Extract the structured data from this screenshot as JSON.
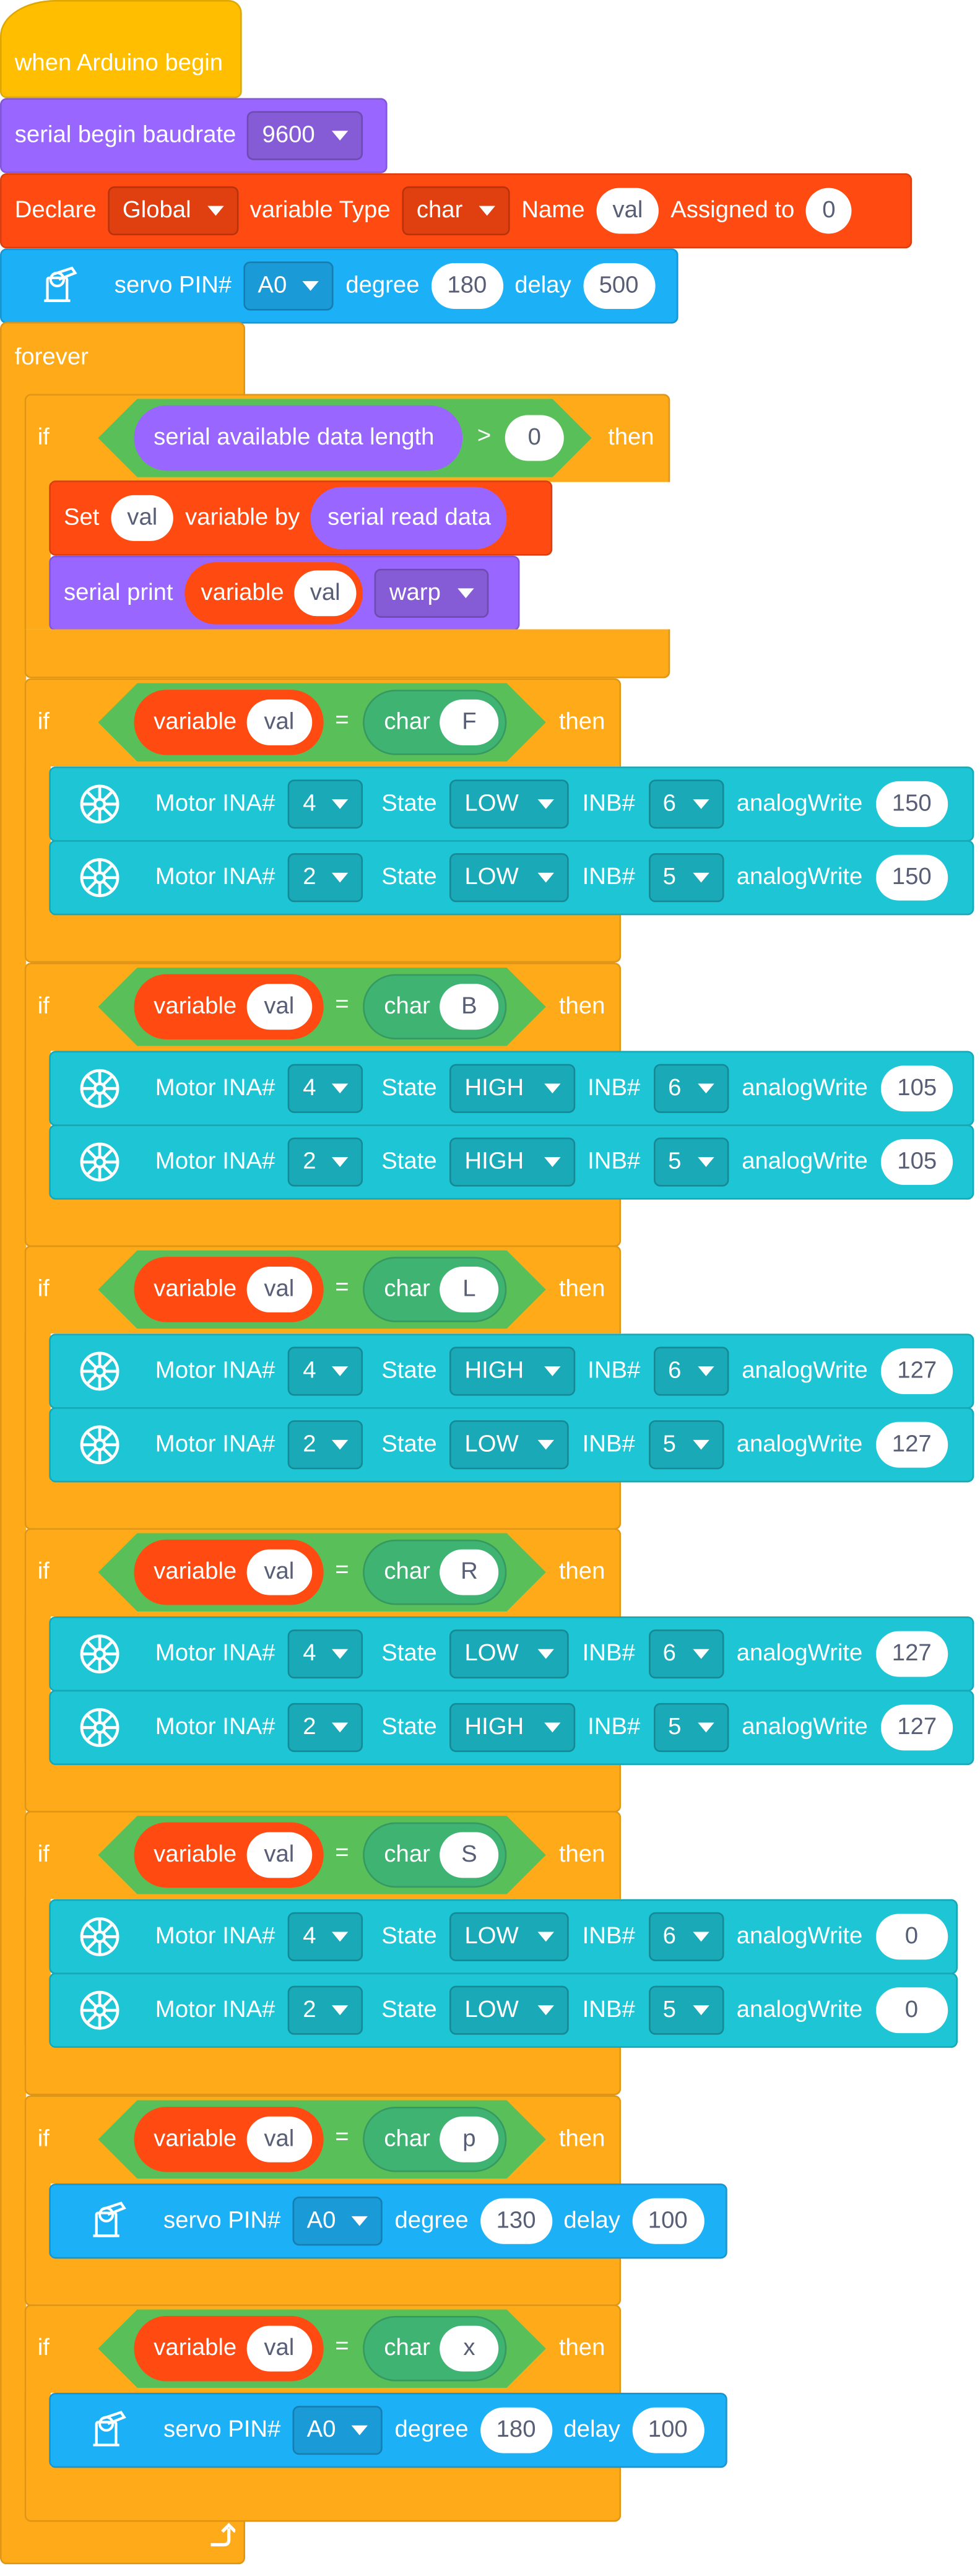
{
  "hat": {
    "label": "when Arduino begin"
  },
  "serial_begin": {
    "label": "serial begin baudrate",
    "baud": "9600"
  },
  "declare": {
    "declare": "Declare",
    "scope": "Global",
    "type_label": "variable Type",
    "type": "char",
    "name_label": "Name",
    "name": "val",
    "assigned_label": "Assigned to",
    "value": "0"
  },
  "servo_init": {
    "label": "servo PIN#",
    "pin": "A0",
    "degree_label": "degree",
    "degree": "180",
    "delay_label": "delay",
    "delay": "500"
  },
  "forever": {
    "label": "forever"
  },
  "if_serial": {
    "if": "if",
    "then": "then",
    "cond_label": "serial available data length",
    "op": ">",
    "value": "0",
    "set": {
      "set": "Set",
      "var": "val",
      "by": "variable by",
      "source": "serial read data"
    },
    "print": {
      "label": "serial print",
      "variable": "variable",
      "var": "val",
      "mode": "warp"
    }
  },
  "conditions": [
    {
      "if": "if",
      "then": "then",
      "variable": "variable",
      "var": "val",
      "eq": "=",
      "char_label": "char",
      "char": "F",
      "actions": [
        {
          "kind": "motor",
          "ina_label": "Motor INA#",
          "ina": "4",
          "state_label": "State",
          "state": "LOW",
          "inb_label": "INB#",
          "inb": "6",
          "aw_label": "analogWrite",
          "aw": "150"
        },
        {
          "kind": "motor",
          "ina_label": "Motor INA#",
          "ina": "2",
          "state_label": "State",
          "state": "LOW",
          "inb_label": "INB#",
          "inb": "5",
          "aw_label": "analogWrite",
          "aw": "150"
        }
      ]
    },
    {
      "if": "if",
      "then": "then",
      "variable": "variable",
      "var": "val",
      "eq": "=",
      "char_label": "char",
      "char": "B",
      "actions": [
        {
          "kind": "motor",
          "ina_label": "Motor INA#",
          "ina": "4",
          "state_label": "State",
          "state": "HIGH",
          "inb_label": "INB#",
          "inb": "6",
          "aw_label": "analogWrite",
          "aw": "105"
        },
        {
          "kind": "motor",
          "ina_label": "Motor INA#",
          "ina": "2",
          "state_label": "State",
          "state": "HIGH",
          "inb_label": "INB#",
          "inb": "5",
          "aw_label": "analogWrite",
          "aw": "105"
        }
      ]
    },
    {
      "if": "if",
      "then": "then",
      "variable": "variable",
      "var": "val",
      "eq": "=",
      "char_label": "char",
      "char": "L",
      "actions": [
        {
          "kind": "motor",
          "ina_label": "Motor INA#",
          "ina": "4",
          "state_label": "State",
          "state": "HIGH",
          "inb_label": "INB#",
          "inb": "6",
          "aw_label": "analogWrite",
          "aw": "127"
        },
        {
          "kind": "motor",
          "ina_label": "Motor INA#",
          "ina": "2",
          "state_label": "State",
          "state": "LOW",
          "inb_label": "INB#",
          "inb": "5",
          "aw_label": "analogWrite",
          "aw": "127"
        }
      ]
    },
    {
      "if": "if",
      "then": "then",
      "variable": "variable",
      "var": "val",
      "eq": "=",
      "char_label": "char",
      "char": "R",
      "actions": [
        {
          "kind": "motor",
          "ina_label": "Motor INA#",
          "ina": "4",
          "state_label": "State",
          "state": "LOW",
          "inb_label": "INB#",
          "inb": "6",
          "aw_label": "analogWrite",
          "aw": "127"
        },
        {
          "kind": "motor",
          "ina_label": "Motor INA#",
          "ina": "2",
          "state_label": "State",
          "state": "HIGH",
          "inb_label": "INB#",
          "inb": "5",
          "aw_label": "analogWrite",
          "aw": "127"
        }
      ]
    },
    {
      "if": "if",
      "then": "then",
      "variable": "variable",
      "var": "val",
      "eq": "=",
      "char_label": "char",
      "char": "S",
      "actions": [
        {
          "kind": "motor",
          "ina_label": "Motor INA#",
          "ina": "4",
          "state_label": "State",
          "state": "LOW",
          "inb_label": "INB#",
          "inb": "6",
          "aw_label": "analogWrite",
          "aw": "0"
        },
        {
          "kind": "motor",
          "ina_label": "Motor INA#",
          "ina": "2",
          "state_label": "State",
          "state": "LOW",
          "inb_label": "INB#",
          "inb": "5",
          "aw_label": "analogWrite",
          "aw": "0"
        }
      ]
    },
    {
      "if": "if",
      "then": "then",
      "variable": "variable",
      "var": "val",
      "eq": "=",
      "char_label": "char",
      "char": "p",
      "actions": [
        {
          "kind": "servo",
          "label": "servo PIN#",
          "pin": "A0",
          "degree_label": "degree",
          "degree": "130",
          "delay_label": "delay",
          "delay": "100"
        }
      ]
    },
    {
      "if": "if",
      "then": "then",
      "variable": "variable",
      "var": "val",
      "eq": "=",
      "char_label": "char",
      "char": "x",
      "actions": [
        {
          "kind": "servo",
          "label": "servo PIN#",
          "pin": "A0",
          "degree_label": "degree",
          "degree": "180",
          "delay_label": "delay",
          "delay": "100"
        }
      ]
    }
  ],
  "icons": {
    "servo": "servo-icon",
    "motor": "motor-wheel-icon",
    "loop": "loop-arrow-icon",
    "dropdown": "caret-down-icon"
  },
  "colors": {
    "events": "#ffbf00",
    "control": "#ffab19",
    "serial": "#9966ff",
    "variables": "#ff4b12",
    "operators": "#59c059",
    "servo": "#1cb0f6",
    "motor": "#1dc5d5"
  }
}
